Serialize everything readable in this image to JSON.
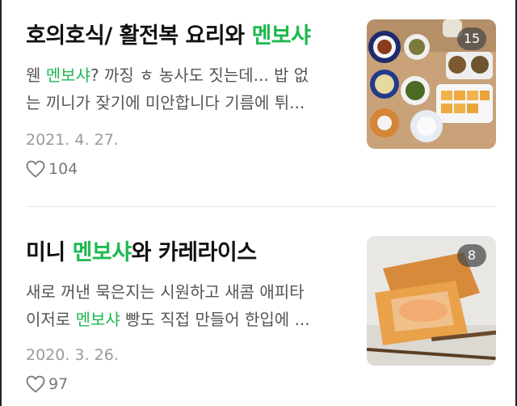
{
  "posts": [
    {
      "title_parts": [
        "호의호식/ 활전복 요리와 ",
        "멘보샤",
        ""
      ],
      "excerpt_line1": [
        "웬 ",
        "멘보샤",
        "? 까징 ㅎ 농사도 짓는데... 밥 없"
      ],
      "excerpt_line2": [
        "는 끼니가 잦기에 미안합니다 기름에 튀...",
        "",
        ""
      ],
      "date": "2021. 4. 27.",
      "likes": "104",
      "photo_count": "15",
      "thumb_icon": "food-table-photo"
    },
    {
      "title_parts": [
        "미니 ",
        "멘보샤",
        "와 카레라이스"
      ],
      "excerpt_line1": [
        "새로 꺼낸 묵은지는 시원하고 새콤 애피타",
        "",
        ""
      ],
      "excerpt_line2": [
        "이저로 ",
        "멘보샤",
        " 빵도 직접 만들어 한입에 ..."
      ],
      "date": "2020. 3. 26.",
      "likes": "97",
      "photo_count": "8",
      "thumb_icon": "fried-toast-photo"
    }
  ],
  "colors": {
    "highlight": "#1fb84f",
    "date": "#9a9a9a",
    "excerpt": "#555555"
  }
}
